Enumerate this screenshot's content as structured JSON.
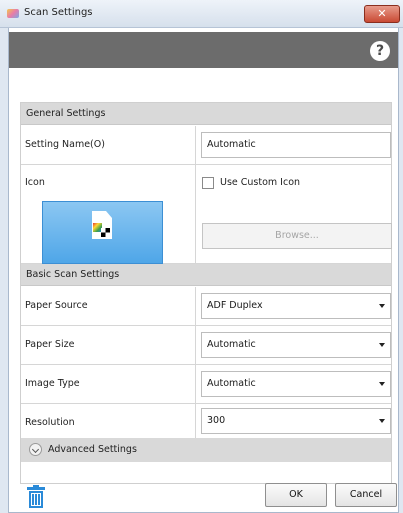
{
  "window": {
    "title": "Scan Settings",
    "close_glyph": "✕"
  },
  "toolbar": {
    "help_glyph": "?",
    "help_icon": "help-icon"
  },
  "general": {
    "header": "General Settings",
    "setting_name_label": "Setting Name(O)",
    "setting_name_value": "Automatic",
    "icon_label": "Icon",
    "use_custom_icon_label": "Use Custom Icon",
    "use_custom_icon_checked": false,
    "browse_label": "Browse..."
  },
  "basic": {
    "header": "Basic Scan Settings",
    "rows": [
      {
        "label": "Paper Source",
        "value": "ADF Duplex"
      },
      {
        "label": "Paper Size",
        "value": "Automatic"
      },
      {
        "label": "Image Type",
        "value": "Automatic"
      },
      {
        "label": "Resolution",
        "value": "300"
      }
    ]
  },
  "advanced": {
    "label": "Advanced Settings",
    "expanded": false
  },
  "footer": {
    "ok_label": "OK",
    "cancel_label": "Cancel",
    "trash_icon": "trash-icon"
  },
  "colors": {
    "accent": "#2a8ad8",
    "header_bar": "#6c6c6c",
    "section_bg": "#d9d9d9"
  }
}
